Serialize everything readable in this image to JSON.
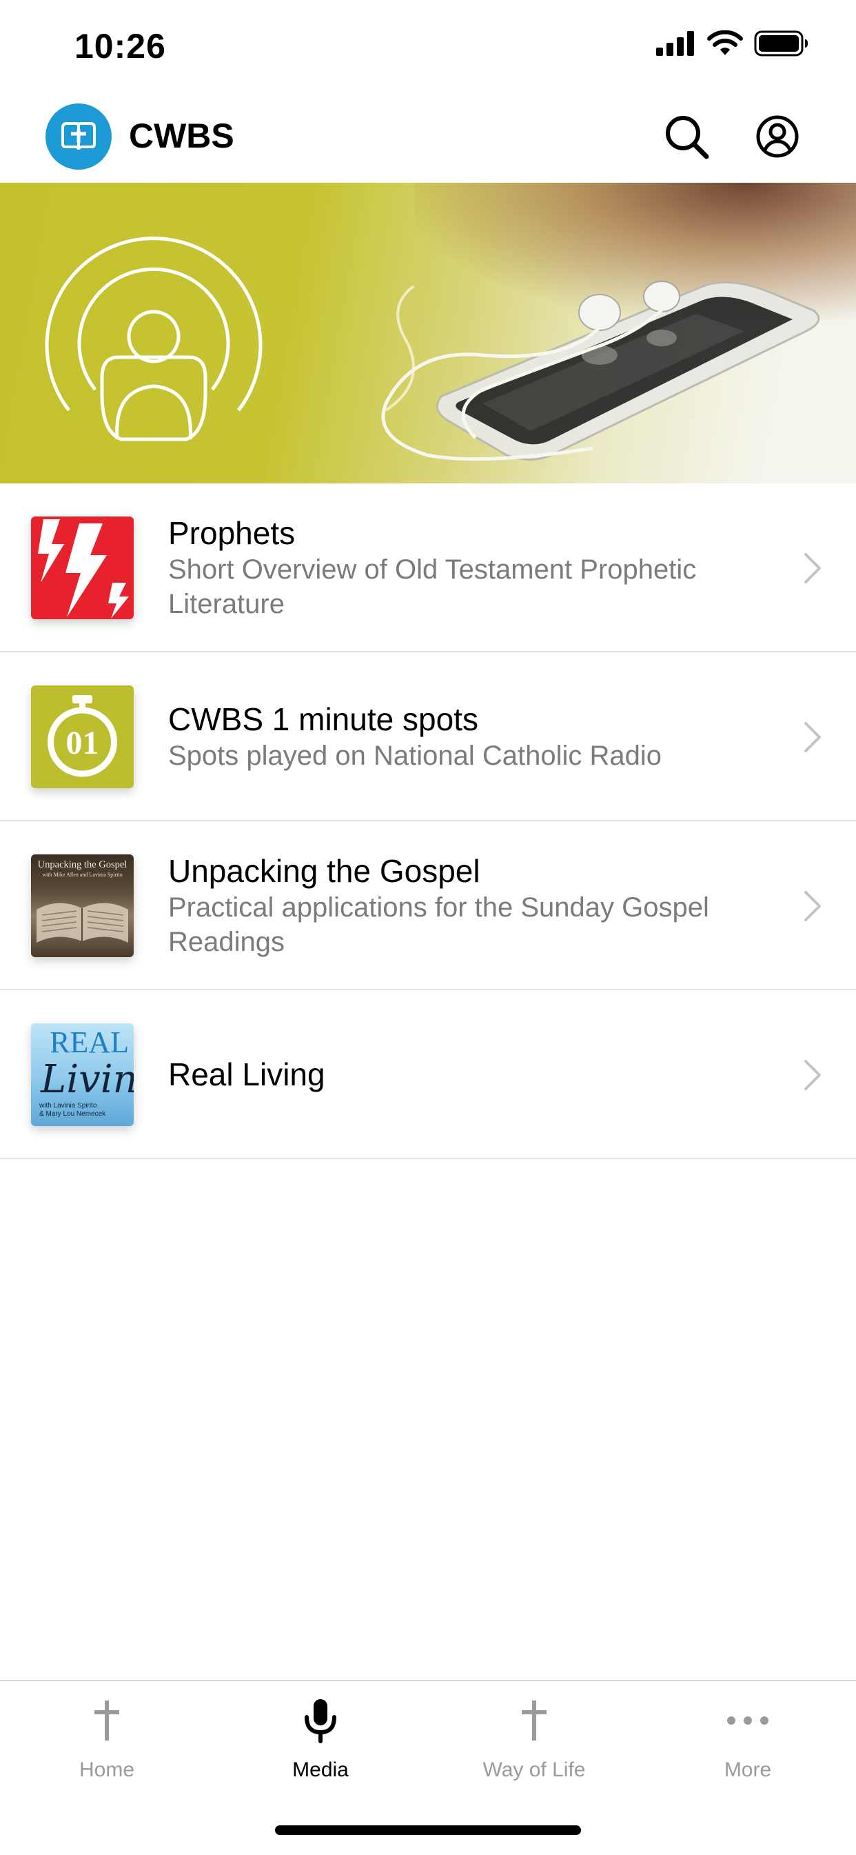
{
  "status_bar": {
    "time": "10:26",
    "icons": [
      "cellular-signal-icon",
      "wifi-icon",
      "battery-icon"
    ]
  },
  "header": {
    "app_name": "CWBS",
    "logo_icon": "cwbs-logo-icon",
    "search_icon": "search-icon",
    "account_icon": "account-icon"
  },
  "banner": {
    "icon": "podcast-icon",
    "image": "earphones-on-smartphone-photo"
  },
  "media_list": [
    {
      "title": "Prophets",
      "subtitle": "Short Overview of Old Testament Prophetic Literature",
      "thumb": "lightning-bolts-thumbnail"
    },
    {
      "title": "CWBS 1 minute spots",
      "subtitle": "Spots played on National Catholic Radio",
      "thumb": "stopwatch-01-thumbnail",
      "thumb_text": "01"
    },
    {
      "title": "Unpacking the Gospel",
      "subtitle": "Practical applications for the Sunday Gospel Readings",
      "thumb": "open-bible-thumbnail",
      "thumb_text": "Unpacking the Gospel",
      "thumb_subtext": "with Mike Allen and Lavinia Spirito"
    },
    {
      "title": "Real Living",
      "subtitle": "",
      "thumb": "real-living-thumbnail",
      "thumb_text_1": "REAL",
      "thumb_text_2": "Living",
      "thumb_subtext_1": "with Lavinia Spirito",
      "thumb_subtext_2": "& Mary Lou Nemecek"
    }
  ],
  "tab_bar": {
    "tabs": [
      {
        "label": "Home",
        "icon": "cross-icon",
        "active": false
      },
      {
        "label": "Media",
        "icon": "microphone-icon",
        "active": true
      },
      {
        "label": "Way of Life",
        "icon": "cross-icon",
        "active": false
      },
      {
        "label": "More",
        "icon": "more-dots-icon",
        "active": false
      }
    ]
  },
  "colors": {
    "brand_blue": "#1c9ad6",
    "banner_yellow": "#c4c12d",
    "prophets_red": "#e8222d",
    "spots_yellow": "#bcbe2e",
    "subtitle_gray": "#7b7b7b",
    "inactive_tab": "#9a9a9a"
  }
}
